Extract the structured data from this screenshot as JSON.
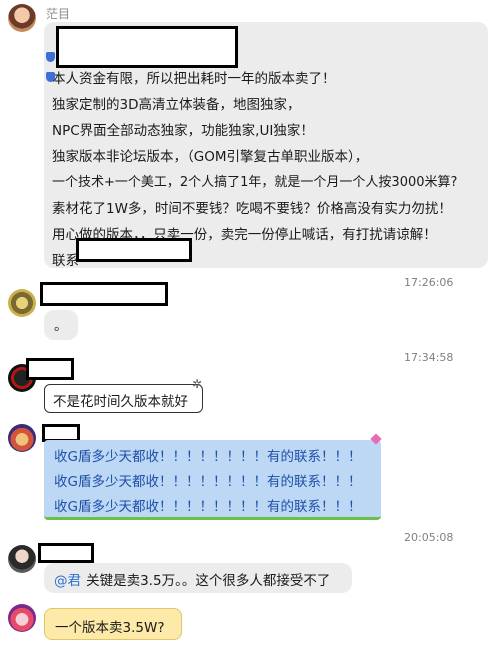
{
  "messages": [
    {
      "sender_name": "茫目",
      "lines": [
        "本人资金有限，所以把出耗时一年的版本卖了！",
        "独家定制的3D高清立体装备，地图独家，",
        "NPC界面全部动态独家，功能独家,UI独家！",
        "独家版本非论坛版本，（GOM引擎复古单职业版本），",
        "一个技术+一个美工，2个人搞了1年，就是一个月一个人按3000米算?",
        "素材花了1W多，时间不要钱？吃喝不要钱？价格高没有实力勿扰！",
        "用心做的版本，，只卖一份，卖完一份停止喊话，有打扰请谅解！",
        "联系"
      ]
    },
    {
      "time": "17:26:06",
      "text": "。"
    },
    {
      "time": "17:34:58",
      "text": "不是花时间久版本就好"
    },
    {
      "lines": [
        "收G盾多少天都收！！！！！！！！有的联系！！！",
        "收G盾多少天都收！！！！！！！！有的联系！！！",
        "收G盾多少天都收！！！！！！！！有的联系！！！"
      ]
    },
    {
      "time": "20:05:08",
      "mention": "@君",
      "text": "关键是卖3.5万。。这个很多人都接受不了"
    },
    {
      "text": "一个版本卖3.5W?"
    }
  ],
  "colors": {
    "bubble_gray": "#ececec",
    "bubble_blue": "#bcd8f5",
    "bubble_yellow": "#fde9a8",
    "mention": "#2b6fd0"
  }
}
